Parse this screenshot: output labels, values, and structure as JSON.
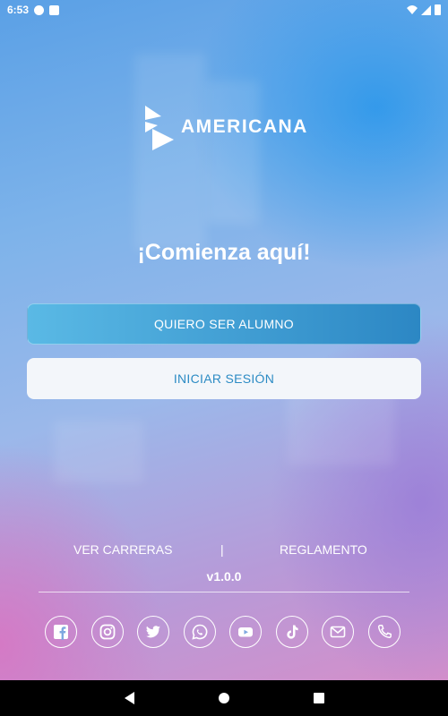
{
  "status_bar": {
    "time": "6:53"
  },
  "brand": {
    "name": "AMERICANA"
  },
  "headline": "¡Comienza aquí!",
  "buttons": {
    "student": "QUIERO SER ALUMNO",
    "login": "INICIAR SESIÓN"
  },
  "footer": {
    "careers_link": "VER CARRERAS",
    "separator": "|",
    "rules_link": "REGLAMENTO",
    "version": "v1.0.0"
  },
  "social_icons": [
    "facebook-icon",
    "instagram-icon",
    "twitter-icon",
    "whatsapp-icon",
    "youtube-icon",
    "tiktok-icon",
    "email-icon",
    "phone-icon"
  ],
  "colors": {
    "primary_button": "#2c87c4",
    "primary_button_light": "#5ab9e5",
    "secondary_button_bg": "#f3f6fa",
    "secondary_button_text": "#2c8bc4"
  }
}
